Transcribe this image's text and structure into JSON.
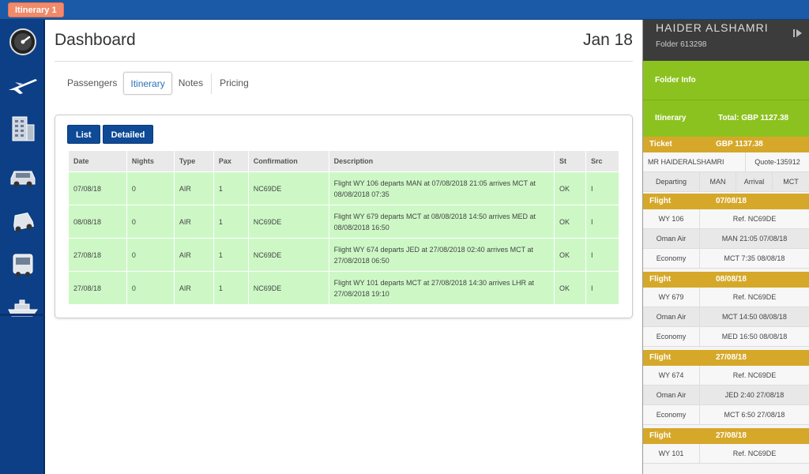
{
  "topbar": {
    "itinerary_tab": "Itinerary 1"
  },
  "sidebar": {
    "icons": [
      "dashboard-gauge-icon",
      "airplane-icon",
      "hotel-building-icon",
      "car-icon",
      "taxi-icon",
      "bus-icon",
      "cruise-ship-icon"
    ]
  },
  "main": {
    "title": "Dashboard",
    "date": "Jan 18",
    "tabs": [
      "Passengers",
      "Itinerary",
      "Notes",
      "Pricing"
    ],
    "active_tab": "Itinerary",
    "buttons": {
      "list": "List",
      "detailed": "Detailed"
    },
    "table": {
      "headers": [
        "Date",
        "Nights",
        "Type",
        "Pax",
        "Confirmation",
        "Description",
        "St",
        "Src"
      ],
      "rows": [
        [
          "07/08/18",
          "0",
          "AIR",
          "1",
          "NC69DE",
          "Flight WY 106 departs MAN at 07/08/2018 21:05 arrives MCT at 08/08/2018 07:35",
          "OK",
          "I"
        ],
        [
          "08/08/18",
          "0",
          "AIR",
          "1",
          "NC69DE",
          "Flight WY 679 departs MCT at 08/08/2018 14:50 arrives MED at 08/08/2018 16:50",
          "OK",
          "I"
        ],
        [
          "27/08/18",
          "0",
          "AIR",
          "1",
          "NC69DE",
          "Flight WY 674 departs JED at 27/08/2018 02:40 arrives MCT at 27/08/2018 06:50",
          "OK",
          "I"
        ],
        [
          "27/08/18",
          "0",
          "AIR",
          "1",
          "NC69DE",
          "Flight WY 101 departs MCT at 27/08/2018 14:30 arrives LHR at 27/08/2018 19:10",
          "OK",
          "I"
        ]
      ]
    }
  },
  "right": {
    "name": "HAIDER ALSHAMRI",
    "folder": "Folder 613298",
    "folder_info": "Folder Info",
    "itinerary_label": "Itinerary",
    "total": "Total: GBP 1127.38",
    "ticket": {
      "label": "Ticket",
      "price": "GBP 1137.38",
      "passenger": "MR HAIDERALSHAMRI",
      "quote": "Quote-135912",
      "departing": "Departing",
      "from": "MAN",
      "arrival": "Arrival",
      "to": "MCT"
    },
    "flights": [
      {
        "label": "Flight",
        "date": "07/08/18",
        "number": "WY 106",
        "ref": "Ref. NC69DE",
        "airline": "Oman Air",
        "dep": "MAN 21:05 07/08/18",
        "cabin": "Economy",
        "arr": "MCT 7:35 08/08/18"
      },
      {
        "label": "Flight",
        "date": "08/08/18",
        "number": "WY 679",
        "ref": "Ref. NC69DE",
        "airline": "Oman Air",
        "dep": "MCT 14:50 08/08/18",
        "cabin": "Economy",
        "arr": "MED 16:50 08/08/18"
      },
      {
        "label": "Flight",
        "date": "27/08/18",
        "number": "WY 674",
        "ref": "Ref. NC69DE",
        "airline": "Oman Air",
        "dep": "JED 2:40 27/08/18",
        "cabin": "Economy",
        "arr": "MCT 6:50 27/08/18"
      },
      {
        "label": "Flight",
        "date": "27/08/18",
        "number": "WY 101",
        "ref": "Ref. NC69DE"
      }
    ]
  }
}
